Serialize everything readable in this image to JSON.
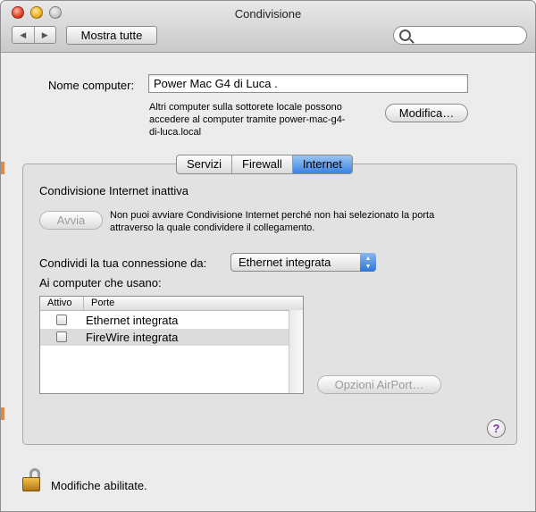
{
  "window": {
    "title": "Condivisione",
    "show_all_label": "Mostra tutte",
    "nav_back_icon": "left-arrow",
    "nav_forward_icon": "right-arrow"
  },
  "computer_name": {
    "label": "Nome computer:",
    "value": "Power Mac G4 di Luca .",
    "info": "Altri computer sulla sottorete locale possono accedere al computer tramite power-mac-g4-di-luca.local",
    "info_lines": [
      "Altri computer sulla sottorete locale possono",
      "accedere al computer tramite power-mac-g4-",
      "di-luca.local"
    ],
    "edit_button": "Modifica…"
  },
  "tabs": [
    {
      "label": "Servizi",
      "selected": false
    },
    {
      "label": "Firewall",
      "selected": false
    },
    {
      "label": "Internet",
      "selected": true
    }
  ],
  "internet": {
    "status": "Condivisione Internet inattiva",
    "start_button": "Avvia",
    "message_lines": [
      "Non puoi avviare Condivisione Internet perché non hai selezionato la porta",
      "attraverso la quale condividere il collegamento."
    ],
    "share_from_label": "Condividi la tua connessione da:",
    "share_from_value": "Ethernet integrata",
    "to_computers_label": "Ai computer che usano:",
    "columns": [
      "Attivo",
      "Porte"
    ],
    "ports": [
      {
        "name": "Ethernet integrata",
        "active": false
      },
      {
        "name": "FireWire integrata",
        "active": false
      }
    ],
    "airport_button": "Opzioni AirPort…"
  },
  "footer": {
    "lock_label": "Modifiche abilitate."
  },
  "colors": {
    "tab_selected": "#3a82e2",
    "help_mark": "#7a33a8"
  }
}
